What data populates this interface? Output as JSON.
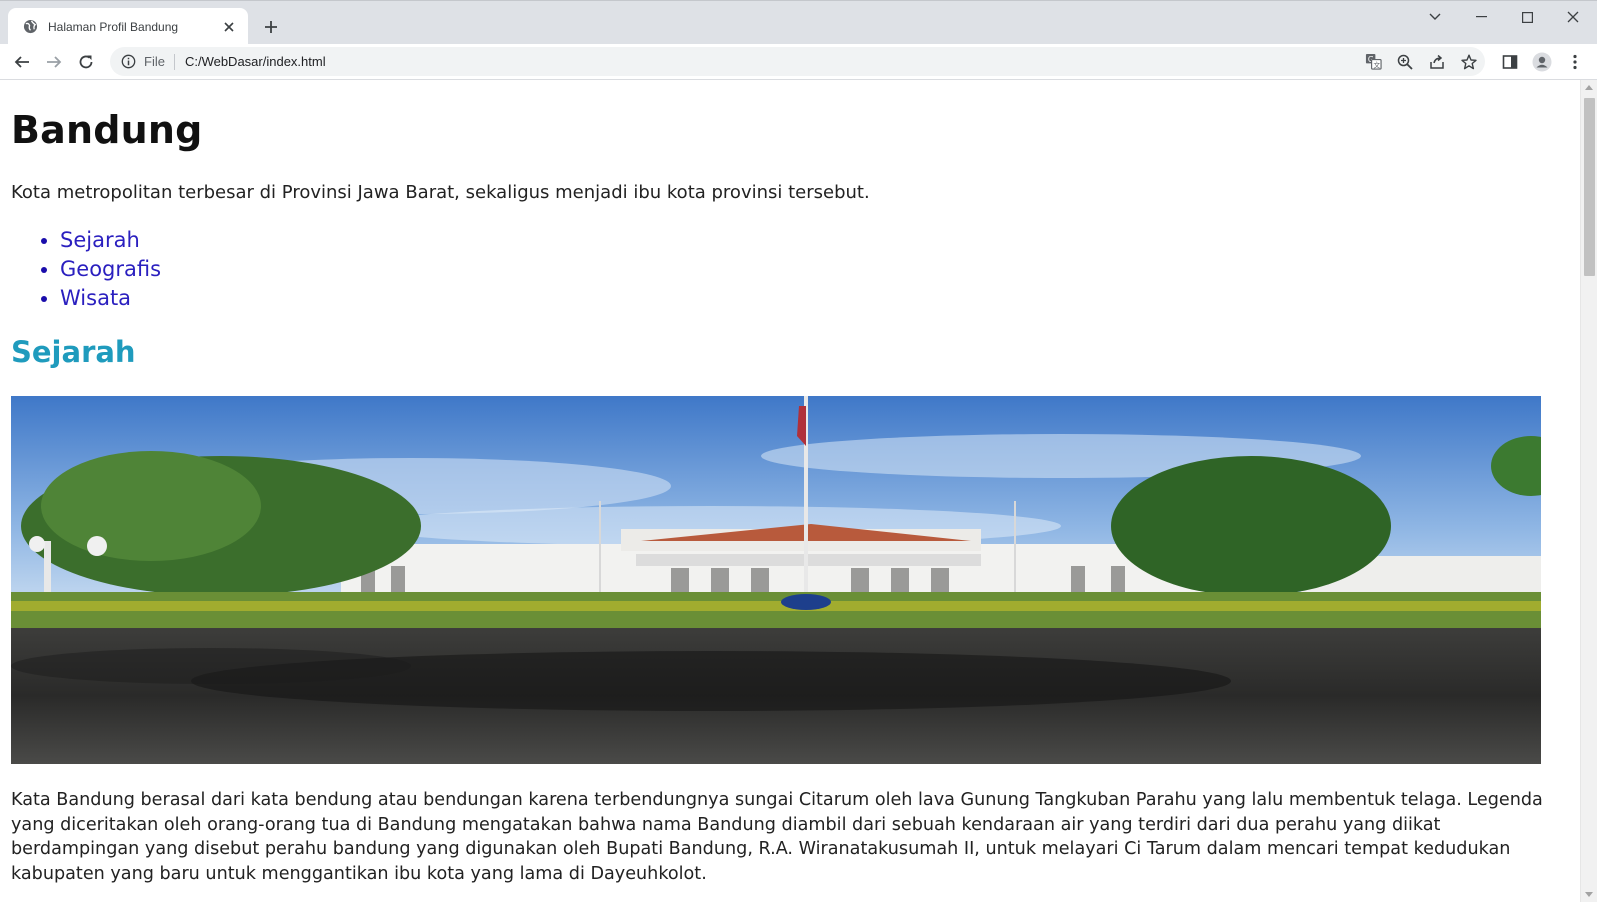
{
  "browser": {
    "tab_title": "Halaman Profil Bandung",
    "close_glyph": "✕",
    "newtab_glyph": "+",
    "scheme_label": "File",
    "url": "C:/WebDasar/index.html"
  },
  "page": {
    "title": "Bandung",
    "tagline": "Kota metropolitan terbesar di Provinsi Jawa Barat, sekaligus menjadi ibu kota provinsi tersebut.",
    "nav_links": [
      "Sejarah",
      "Geografis",
      "Wisata"
    ],
    "section_title": "Sejarah",
    "paragraph": "Kata Bandung berasal dari kata bendung atau bendungan karena terbendungnya sungai Citarum oleh lava Gunung Tangkuban Parahu yang lalu membentuk telaga. Legenda yang diceritakan oleh orang-orang tua di Bandung mengatakan bahwa nama Bandung diambil dari sebuah kendaraan air yang terdiri dari dua perahu yang diikat berdampingan yang disebut perahu bandung yang digunakan oleh Bupati Bandung, R.A. Wiranatakusumah II, untuk melayari Ci Tarum dalam mencari tempat kedudukan kabupaten yang baru untuk menggantikan ibu kota yang lama di Dayeuhkolot."
  },
  "colors": {
    "heading_accent": "#1f9bbd",
    "link": "#2a1fbf",
    "tabstrip_bg": "#dee1e6",
    "omnibox_bg": "#f1f3f4"
  },
  "icons": {
    "favicon": "globe-icon",
    "back": "arrow-left-icon",
    "forward": "arrow-right-icon",
    "reload": "reload-icon",
    "site_info": "info-circle-icon",
    "translate": "translate-icon",
    "zoom": "zoom-icon",
    "share": "share-icon",
    "bookmark": "star-icon",
    "side_panel": "side-panel-icon",
    "profile": "profile-icon",
    "menu": "kebab-menu-icon"
  }
}
